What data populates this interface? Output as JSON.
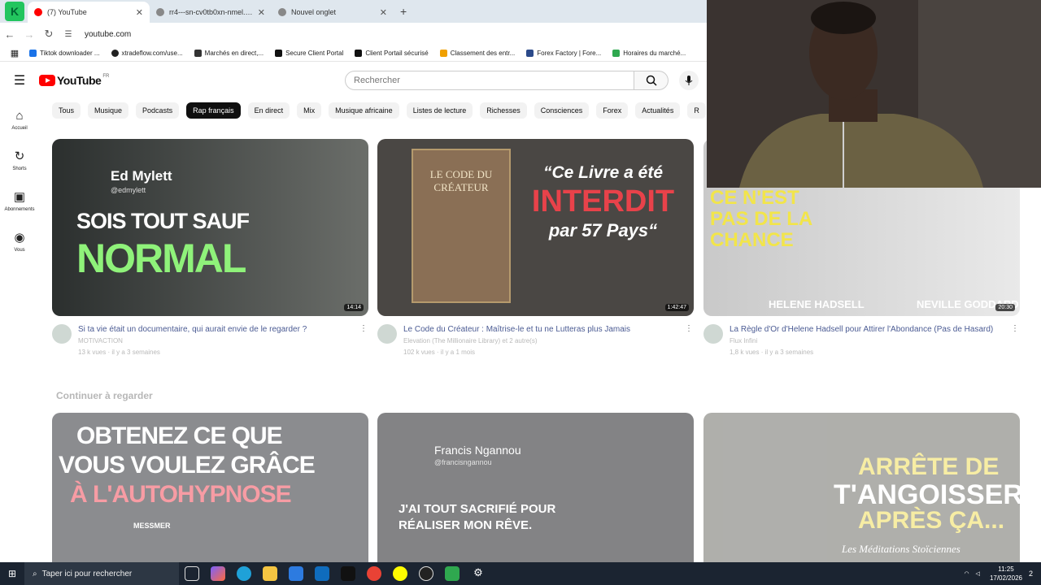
{
  "browser": {
    "tabs": [
      {
        "title": "(7) YouTube",
        "color": "#ff0000"
      },
      {
        "title": "rr4---sn-cv0tb0xn-nmel.googlevideo.com",
        "color": "#777"
      },
      {
        "title": "Nouvel onglet",
        "color": "#777"
      }
    ],
    "new_tab": "+",
    "url": "youtube.com",
    "bookmarks": [
      {
        "label": "Tiktok downloader ...",
        "color": "#1a73e8"
      },
      {
        "label": "xtradeflow.com/use...",
        "color": "#222"
      },
      {
        "label": "Marchés en direct,...",
        "color": "#333"
      },
      {
        "label": "Secure Client Portal",
        "color": "#111"
      },
      {
        "label": "Client Portail sécurisé",
        "color": "#111"
      },
      {
        "label": "Classement des entr...",
        "color": "#f0a000"
      },
      {
        "label": "Forex Factory | Fore...",
        "color": "#2b4a8a"
      },
      {
        "label": "Horaires du marché...",
        "color": "#2fa84f"
      }
    ]
  },
  "youtube": {
    "logo_text": "YouTube",
    "logo_region": "FR",
    "search_placeholder": "Rechercher",
    "sidebar": [
      {
        "label": "Accueil",
        "icon": "⌂"
      },
      {
        "label": "Shorts",
        "icon": "↻"
      },
      {
        "label": "Abonnements",
        "icon": "▣"
      },
      {
        "label": "Vous",
        "icon": "◉"
      }
    ],
    "chips": [
      "Tous",
      "Musique",
      "Podcasts",
      "Rap français",
      "En direct",
      "Mix",
      "Musique africaine",
      "Listes de lecture",
      "Richesses",
      "Consciences",
      "Forex",
      "Actualités",
      "R"
    ],
    "active_chip": "Rap français",
    "videos": [
      {
        "title": "Si ta vie était un documentaire, qui aurait envie de le regarder ?",
        "channel": "MOTIVACTION",
        "stats": "13 k vues · il y a 3 semaines",
        "duration": "14:14",
        "thumb_text_1": "Ed Mylett",
        "thumb_text_2": "@edmylett",
        "thumb_text_3": "SOIS TOUT SAUF",
        "thumb_text_4": "NORMAL",
        "bg": "#3b3f3e"
      },
      {
        "title": "Le Code du Créateur : Maîtrise-le et tu ne Lutteras plus Jamais",
        "channel": "Elevation (The Millionaire Library) et 2 autre(s)",
        "stats": "102 k vues · il y a 1 mois",
        "duration": "1:42:47",
        "thumb_text_1": "LE CODE DU CRÉATEUR",
        "thumb_text_2": "“Ce Livre a été",
        "thumb_text_3": "INTERDIT",
        "thumb_text_4": "par 57 Pays“",
        "bg": "#4a4744"
      },
      {
        "title": "La Règle d'Or d'Helene Hadsell pour Attirer l'Abondance (Pas de Hasard)",
        "channel": "Flux Infini",
        "stats": "1,8 k vues · il y a 3 semaines",
        "duration": "20:30",
        "thumb_text_1": "CE N'EST PAS DE LA CHANCE",
        "thumb_text_2": "HELENE HADSELL",
        "thumb_text_3": "NEVILLE GODDARD",
        "bg": "#d7d7d7"
      }
    ],
    "continue_title": "Continuer à regarder",
    "continue": [
      {
        "line1": "OBTENEZ CE QUE",
        "line2": "VOUS VOULEZ GRÂCE",
        "line3": "À L'AUTOHYPNOSE",
        "line4": "MESSMER"
      },
      {
        "line1": "Francis Ngannou",
        "line2": "@francisngannou",
        "line3": "J'AI TOUT SACRIFIÉ POUR",
        "line4": "RÉALISER MON RÊVE."
      },
      {
        "line1": "ARRÊTE DE",
        "line2": "T'ANGOISSER",
        "line3": "APRÈS ÇA...",
        "line4": "Les Méditations Stoïciennes"
      }
    ]
  },
  "taskbar": {
    "search": "Taper ici pour rechercher",
    "time": "11:25",
    "date": "17/02/2026",
    "notif": "2"
  }
}
